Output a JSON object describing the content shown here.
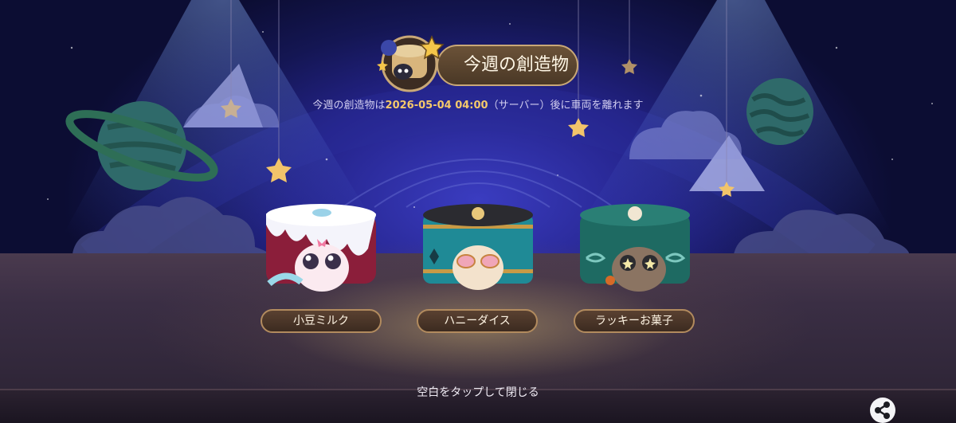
{
  "header": {
    "title": "今週の創造物"
  },
  "notice": {
    "prefix": "今週の創造物は",
    "datetime": "2026-05-04 04:00",
    "suffix": "（サーバー）後に車両を離れます"
  },
  "creatures": [
    {
      "name": "小豆ミルク",
      "icon": "adzuki-milk-cake-creature"
    },
    {
      "name": "ハニーダイス",
      "icon": "honey-dice-cake-creature"
    },
    {
      "name": "ラッキーお菓子",
      "icon": "lucky-sweets-cake-creature"
    }
  ],
  "footer": {
    "hint": "空白をタップして閉じる",
    "share_icon": "share-icon"
  },
  "colors": {
    "highlight": "#f5c96b",
    "plate": "#4a3826",
    "plate_border": "#c9a877"
  }
}
